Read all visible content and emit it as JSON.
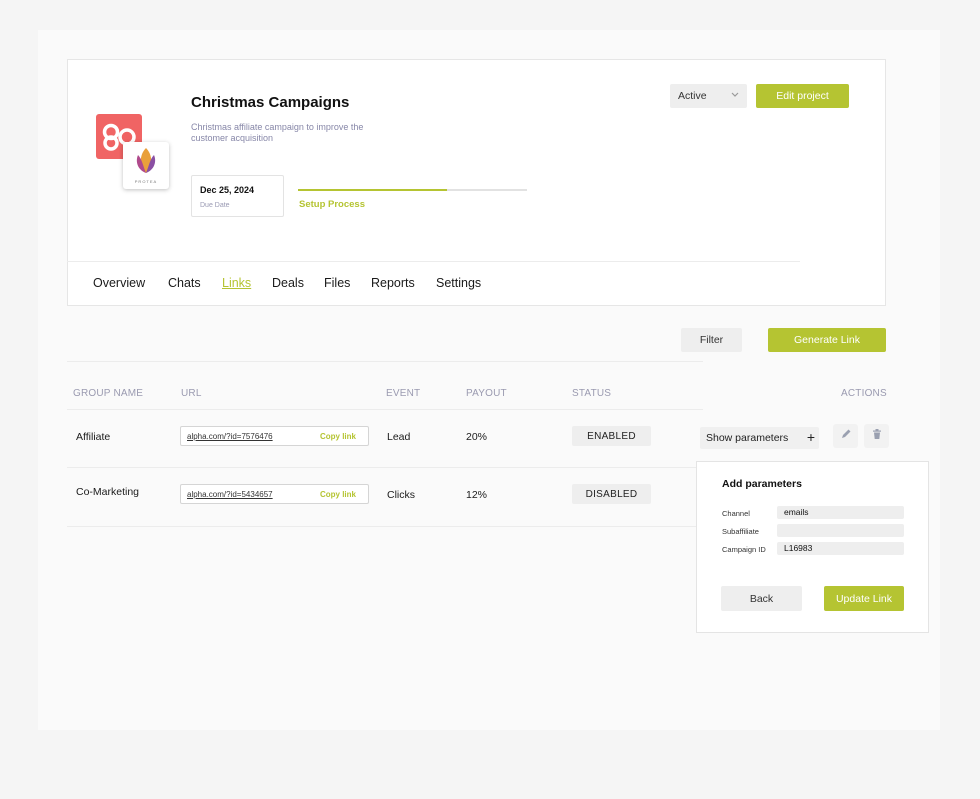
{
  "project": {
    "title": "Christmas Campaigns",
    "description": "Christmas affiliate campaign to improve the customer acquisition",
    "logo_secondary_text": "PROTEA",
    "due_date": "Dec 25, 2024",
    "due_date_label": "Due Date",
    "progress_label": "Setup Process",
    "progress_fraction": 0.65,
    "status": "Active",
    "edit_button": "Edit project"
  },
  "tabs": [
    {
      "label": "Overview",
      "active": false
    },
    {
      "label": "Chats",
      "active": false
    },
    {
      "label": "Links",
      "active": true
    },
    {
      "label": "Deals",
      "active": false
    },
    {
      "label": "Files",
      "active": false
    },
    {
      "label": "Reports",
      "active": false
    },
    {
      "label": "Settings",
      "active": false
    }
  ],
  "toolbar": {
    "filter_label": "Filter",
    "generate_label": "Generate Link"
  },
  "table": {
    "headers": [
      "GROUP NAME",
      "URL",
      "EVENT",
      "PAYOUT",
      "STATUS",
      "ACTIONS"
    ],
    "rows": [
      {
        "group": "Affiliate",
        "url": "alpha.com/?id=7576476",
        "copy": "Copy link",
        "event": "Lead",
        "payout": "20%",
        "status": "ENABLED"
      },
      {
        "group": "Co-Marketing",
        "url": "alpha.com/?id=5434657",
        "copy": "Copy link",
        "event": "Clicks",
        "payout": "12%",
        "status": "DISABLED"
      }
    ],
    "show_parameters_label": "Show parameters",
    "plus": "+"
  },
  "popup": {
    "title": "Add parameters",
    "fields": [
      {
        "label": "Channel",
        "value": "emails"
      },
      {
        "label": "Subaffiliate",
        "value": ""
      },
      {
        "label": "Campaign ID",
        "value": "L16983"
      }
    ],
    "back_label": "Back",
    "update_label": "Update Link"
  },
  "colors": {
    "accent": "#b5c432",
    "logo_red": "#f06464"
  },
  "icons": [
    "chevron-down-icon",
    "plus-icon",
    "pencil-icon",
    "trash-icon"
  ]
}
